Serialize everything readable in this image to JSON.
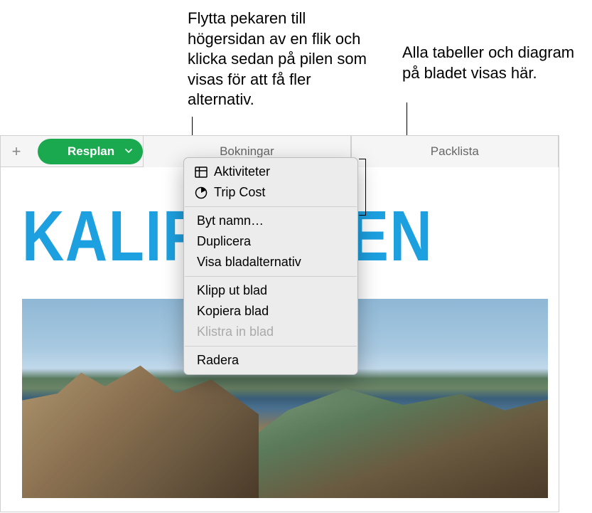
{
  "callouts": {
    "left": "Flytta pekaren till högersidan av en flik och klicka sedan på pilen som visas för att få fler alternativ.",
    "right": "Alla tabeller och diagram på bladet visas här."
  },
  "tabs": {
    "active": "Resplan",
    "second": "Bokningar",
    "third": "Packlista"
  },
  "canvas": {
    "title": "KALIFORNIEN"
  },
  "menu": {
    "items": {
      "activities": "Aktiviteter",
      "trip_cost": "Trip Cost",
      "rename": "Byt namn…",
      "duplicate": "Duplicera",
      "show_options": "Visa bladalternativ",
      "cut": "Klipp ut blad",
      "copy": "Kopiera blad",
      "paste": "Klistra in blad",
      "delete": "Radera"
    }
  }
}
